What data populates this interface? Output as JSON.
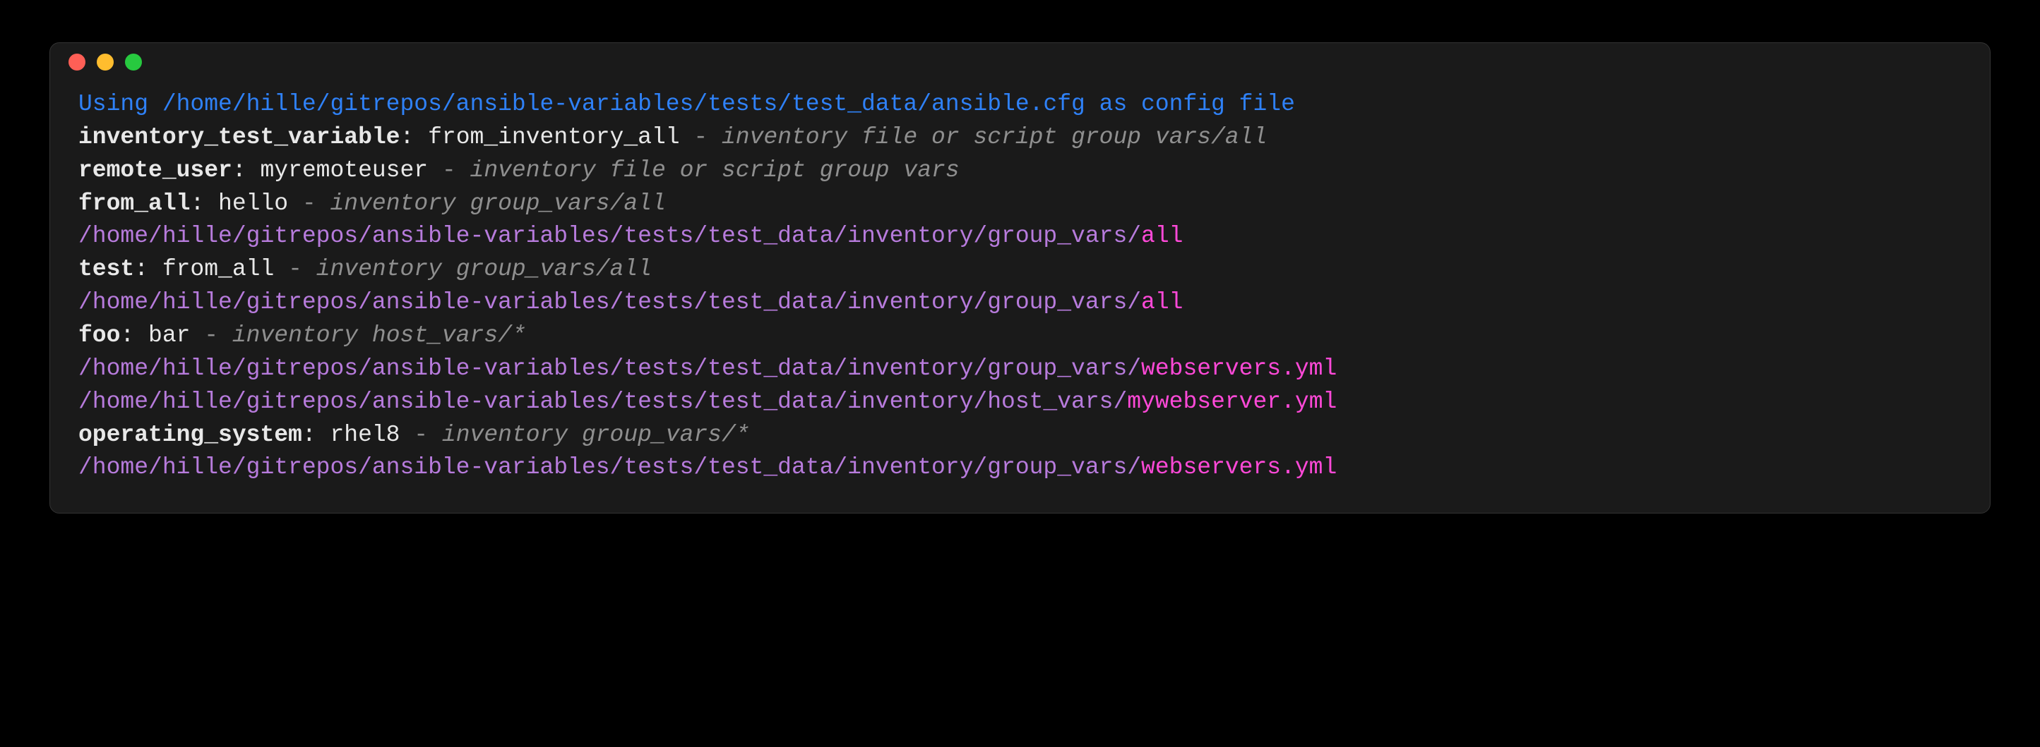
{
  "config_line": "Using /home/hille/gitrepos/ansible-variables/tests/test_data/ansible.cfg as config file",
  "vars": [
    {
      "name": "inventory_test_variable",
      "colon": ": ",
      "value": "from_inventory_all",
      "sep": " - ",
      "source": "inventory file or script group vars/all"
    },
    {
      "name": "remote_user",
      "colon": ": ",
      "value": "myremoteuser",
      "sep": " - ",
      "source": "inventory file or script group vars"
    },
    {
      "name": "from_all",
      "colon": ": ",
      "value": "hello",
      "sep": " - ",
      "source": "inventory group_vars/all"
    }
  ],
  "path1": {
    "prefix": "/home/hille/gitrepos/ansible-variables/tests/test_data/inventory/group_vars/",
    "tail": "all"
  },
  "var_test": {
    "name": "test",
    "colon": ": ",
    "value": "from_all",
    "sep": " - ",
    "source": "inventory group_vars/all"
  },
  "path2": {
    "prefix": "/home/hille/gitrepos/ansible-variables/tests/test_data/inventory/group_vars/",
    "tail": "all"
  },
  "var_foo": {
    "name": "foo",
    "colon": ": ",
    "value": "bar",
    "sep": " - ",
    "source": "inventory host_vars/*"
  },
  "path3": {
    "prefix": "/home/hille/gitrepos/ansible-variables/tests/test_data/inventory/group_vars/",
    "tail": "webservers.yml"
  },
  "path4": {
    "prefix": "/home/hille/gitrepos/ansible-variables/tests/test_data/inventory/host_vars/",
    "tail": "mywebserver.yml"
  },
  "var_os": {
    "name": "operating_system",
    "colon": ": ",
    "value": "rhel8",
    "sep": " - ",
    "source": "inventory group_vars/*"
  },
  "path5": {
    "prefix": "/home/hille/gitrepos/ansible-variables/tests/test_data/inventory/group_vars/",
    "tail": "webservers.yml"
  }
}
